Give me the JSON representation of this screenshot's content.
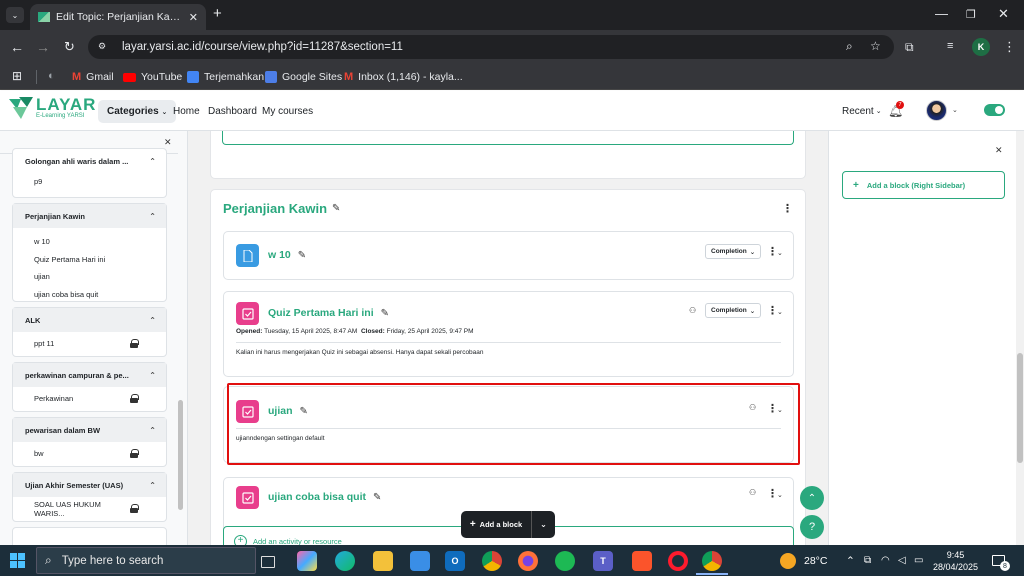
{
  "browser": {
    "tab_title": "Edit Topic: Perjanjian Kawin | te",
    "url": "layar.yarsi.ac.id/course/view.php?id=11287&section=11",
    "profile_initial": "K",
    "bookmarks": [
      {
        "label": "Gmail",
        "icon": "gmail-icon"
      },
      {
        "label": "YouTube",
        "icon": "youtube-icon"
      },
      {
        "label": "Terjemahkan",
        "icon": "translate-icon"
      },
      {
        "label": "Google Sites",
        "icon": "sites-icon"
      },
      {
        "label": "Inbox (1,146) - kayla...",
        "icon": "gmail-icon"
      }
    ]
  },
  "site": {
    "logo_text": "LAYAR",
    "logo_sub": "E-Learning YARSI",
    "nav": {
      "categories": "Categories",
      "home": "Home",
      "dashboard": "Dashboard",
      "my_courses": "My courses"
    },
    "recent": "Recent",
    "notification_count": "7"
  },
  "left_drawer": {
    "sections": [
      {
        "title": "Golongan ahli waris dalam ...",
        "items": [
          {
            "label": "p9",
            "locked": false
          }
        ]
      },
      {
        "title": "Perjanjian Kawin",
        "items": [
          {
            "label": "w 10",
            "locked": false
          },
          {
            "label": "Quiz Pertama Hari ini",
            "locked": false
          },
          {
            "label": "ujian",
            "locked": false
          },
          {
            "label": "ujian coba bisa quit",
            "locked": false
          }
        ]
      },
      {
        "title": "ALK",
        "items": [
          {
            "label": "ppt 11",
            "locked": true
          }
        ]
      },
      {
        "title": "perkawinan campuran & pe...",
        "items": [
          {
            "label": "Perkawinan",
            "locked": true
          }
        ]
      },
      {
        "title": "pewarisan dalam BW",
        "items": [
          {
            "label": "bw",
            "locked": true
          }
        ]
      },
      {
        "title": "Ujian Akhir Semester (UAS)",
        "items": [
          {
            "label": "SOAL UAS HUKUM WARIS...",
            "locked": true
          }
        ]
      }
    ]
  },
  "main": {
    "section_title": "Perjanjian Kawin",
    "completion_label": "Completion",
    "activities": [
      {
        "title": "w 10",
        "type": "file"
      },
      {
        "title": "Quiz Pertama Hari ini",
        "type": "quiz",
        "opened_label": "Opened:",
        "opened_value": "Tuesday, 15 April 2025, 8:47 AM",
        "closed_label": "Closed:",
        "closed_value": "Friday, 25 April 2025, 9:47 PM",
        "description": "Kalian ini harus mengerjakan Quiz ini sebagai absensi. Hanya dapat sekali percobaan"
      },
      {
        "title": "ujian",
        "type": "quiz",
        "description": "ujianndengan settingan default"
      },
      {
        "title": "ujian coba bisa quit",
        "type": "quiz"
      }
    ],
    "add_activity": "Add an activity or resource",
    "add_block": "Add a block"
  },
  "right_drawer": {
    "add_block": "Add a block (Right Sidebar)"
  },
  "taskbar": {
    "search_placeholder": "Type here to search",
    "weather": "28°C",
    "time": "9:45",
    "date": "28/04/2025",
    "notifications": "8"
  },
  "colors": {
    "brand": "#2aa87e",
    "quiz": "#e83e8c",
    "file": "#399be2",
    "highlight": "#e10f0f"
  }
}
